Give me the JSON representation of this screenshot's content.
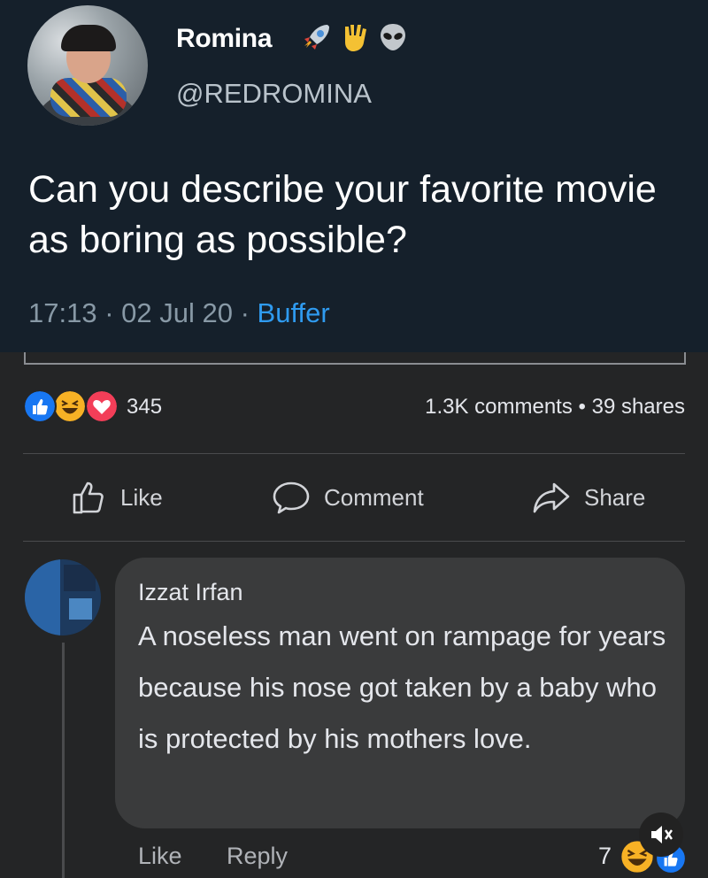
{
  "tweet": {
    "display_name": "Romina",
    "handle": "@REDROMINA",
    "text": "Can you describe your favorite movie as boring as possible?",
    "time": "17:13",
    "date": "02 Jul 20",
    "source": "Buffer",
    "name_emojis": [
      "rocket-emoji",
      "vulcan-salute-emoji",
      "alien-emoji"
    ]
  },
  "post": {
    "reaction_count": "345",
    "comments": "1.3K comments",
    "shares": "39 shares",
    "reaction_icons": [
      "like-reaction-icon",
      "haha-reaction-icon",
      "love-reaction-icon"
    ]
  },
  "actions": {
    "like": "Like",
    "comment": "Comment",
    "share": "Share"
  },
  "comment": {
    "author": "Izzat Irfan",
    "text": "A noseless man went on rampage for years because his nose got taken by a baby who is protected by his mothers love.",
    "like_label": "Like",
    "reply_label": "Reply",
    "reaction_count": "7"
  },
  "colors": {
    "tweet_bg": "#15202b",
    "fb_bg": "#242526",
    "bubble_bg": "#3a3b3c",
    "link_blue": "#2f9bf0"
  }
}
